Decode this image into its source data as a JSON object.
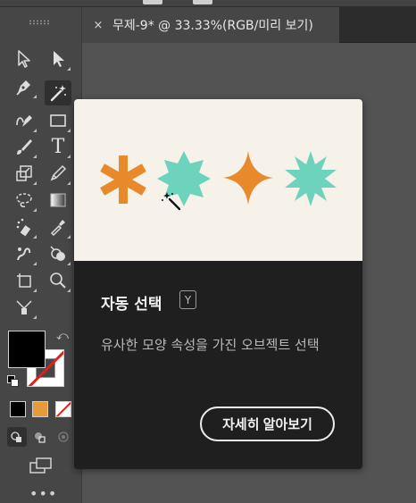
{
  "document": {
    "tab_title": "무제-9* @ 33.33%(RGB/미리 보기)",
    "close_glyph": "×"
  },
  "toolbar": {
    "tools": [
      {
        "name": "selection-tool",
        "icon": "arrow-outline-icon"
      },
      {
        "name": "direct-selection-tool",
        "icon": "arrow-filled-icon"
      },
      {
        "name": "pen-tool",
        "icon": "pen-icon"
      },
      {
        "name": "magic-wand-tool",
        "icon": "magic-wand-icon",
        "active": true
      },
      {
        "name": "curvature-tool",
        "icon": "curvature-pen-icon"
      },
      {
        "name": "rectangle-tool",
        "icon": "rectangle-icon"
      },
      {
        "name": "paintbrush-tool",
        "icon": "brush-icon"
      },
      {
        "name": "type-tool",
        "icon": "type-icon",
        "glyph": "T"
      },
      {
        "name": "scale-tool",
        "icon": "scale-icon"
      },
      {
        "name": "pencil-tool",
        "icon": "pencil-icon"
      },
      {
        "name": "lasso-tool",
        "icon": "lasso-icon"
      },
      {
        "name": "gradient-tool",
        "icon": "gradient-icon"
      },
      {
        "name": "symbol-sprayer-tool",
        "icon": "sprayer-icon"
      },
      {
        "name": "eyedropper-tool",
        "icon": "eyedropper-icon"
      },
      {
        "name": "puppet-warp-tool",
        "icon": "puppet-warp-icon"
      },
      {
        "name": "shape-builder-tool",
        "icon": "shape-builder-icon"
      },
      {
        "name": "artboard-tool",
        "icon": "artboard-icon"
      },
      {
        "name": "zoom-tool",
        "icon": "zoom-icon"
      },
      {
        "name": "blend-tool",
        "icon": "blend-icon"
      }
    ],
    "fill_color": "#000000",
    "stroke_color": "none",
    "swap_glyph": "⤺",
    "more_glyph": "•••"
  },
  "tooltip": {
    "title": "자동 선택",
    "shortcut": "Y",
    "description": "유사한 모양 속성을 가진 오브젝트 선택",
    "button_label": "자세히 알아보기",
    "preview_colors": {
      "orange": "#e8892c",
      "teal": "#6dd3bc",
      "background": "#f6f1e9"
    }
  }
}
